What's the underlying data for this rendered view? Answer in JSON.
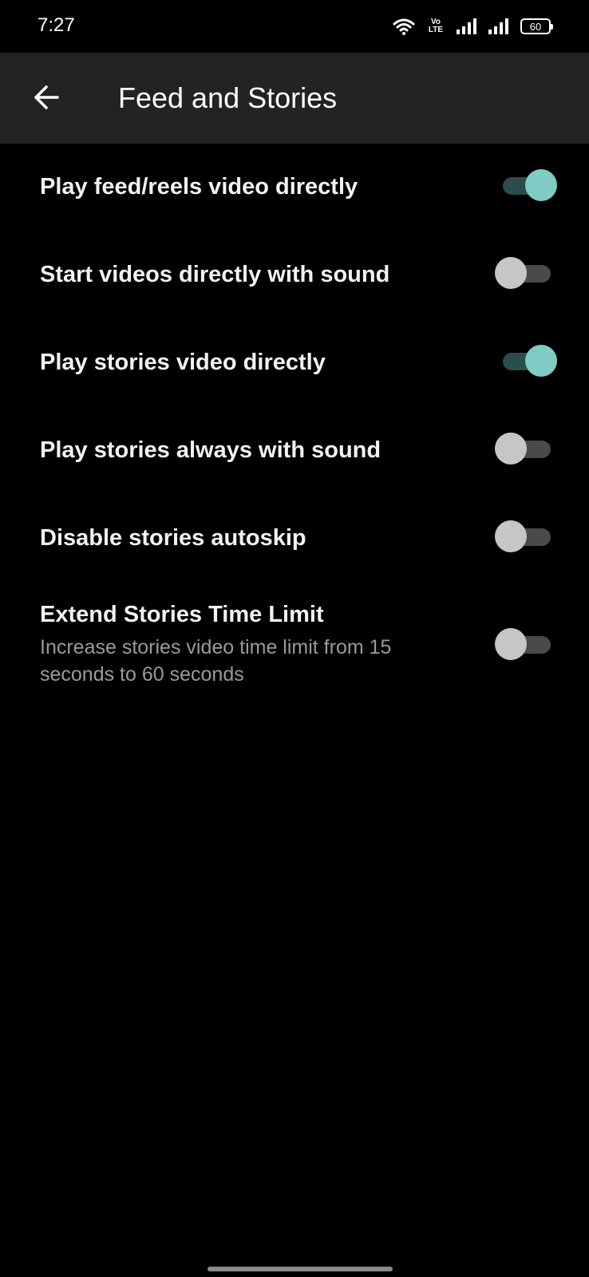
{
  "status_bar": {
    "time": "7:27",
    "volte_line1": "Vo",
    "volte_line2": "LTE",
    "battery_level": "60",
    "icons": [
      "wifi-icon",
      "volte-icon",
      "signal-icon",
      "signal-icon",
      "battery-icon"
    ]
  },
  "app_bar": {
    "back_icon": "arrow-left-icon",
    "title": "Feed and Stories",
    "background": "#232323"
  },
  "settings": [
    {
      "title": "Play feed/reels video directly",
      "enabled": true
    },
    {
      "title": "Start videos directly with sound",
      "enabled": false
    },
    {
      "title": "Play stories video directly",
      "enabled": true
    },
    {
      "title": "Play stories always with sound",
      "enabled": false
    },
    {
      "title": "Disable stories autoskip",
      "enabled": false
    },
    {
      "title": "Extend Stories Time Limit",
      "summary": "Increase stories video time limit from 15 seconds to 60 seconds",
      "enabled": false
    }
  ],
  "colors": {
    "accent": "#80cbc4",
    "accent_track": "#2a4e4c",
    "thumb_off": "#c6c6c6",
    "track_off": "#4a4a4a",
    "background": "#000000"
  }
}
